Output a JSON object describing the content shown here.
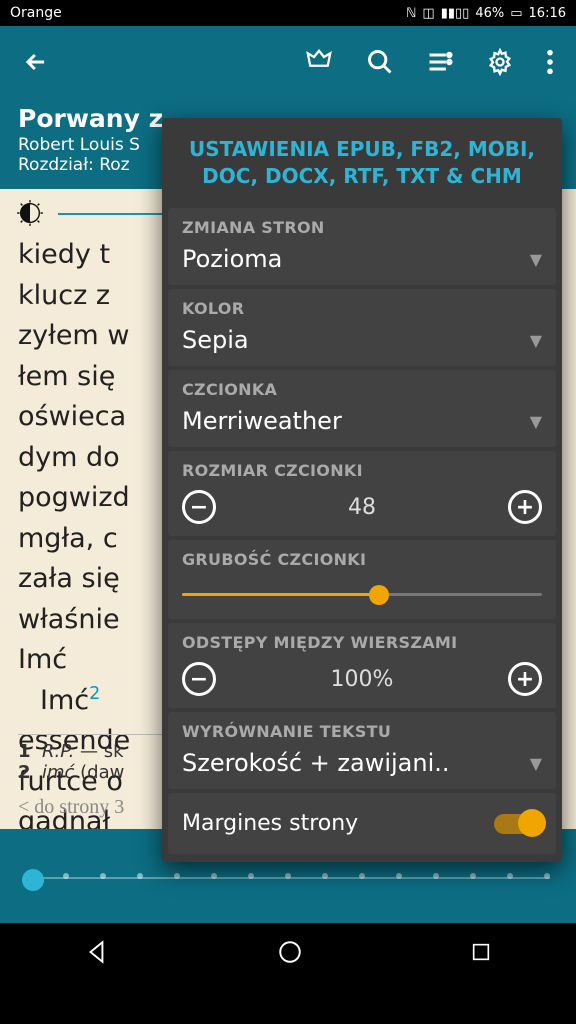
{
  "status": {
    "carrier": "Orange",
    "battery_pct": "46%",
    "time": "16:16"
  },
  "header": {
    "title": "Porwany z",
    "author": "Robert Louis S",
    "chapter": "Rozdział: Roz"
  },
  "reader": {
    "body": "kiedy t\nklucz z\nzyłem w\nłem się\noświeca\ndym do\npogwizd\nmgła, c\nzała się\nwłaśnie\n  Imć",
    "body_sup_ref": "2",
    "body_tail": "essende\nfurtce o\ngadnął",
    "footnote1_num": "1",
    "footnote1_a": "R.P.",
    "footnote1_b": " — sk",
    "footnote2_num": "2",
    "footnote2_a": "imć",
    "footnote2_b": " (daw",
    "page_nav": "< do strony 3"
  },
  "settings": {
    "panel_title": "USTAWIENIA EPUB, FB2, MOBI, DOC, DOCX, RTF, TXT & CHM",
    "page_change": {
      "label": "ZMIANA STRON",
      "value": "Pozioma"
    },
    "color": {
      "label": "KOLOR",
      "value": "Sepia"
    },
    "font": {
      "label": "CZCIONKA",
      "value": "Merriweather"
    },
    "font_size": {
      "label": "ROZMIAR CZCIONKI",
      "value": "48"
    },
    "font_weight": {
      "label": "GRUBOŚĆ CZCIONKI"
    },
    "line_spacing": {
      "label": "ODSTĘPY MIĘDZY WIERSZAMI",
      "value": "100%"
    },
    "text_align": {
      "label": "WYRÓWNANIE TEKSTU",
      "value": "Szerokość + zawijani.."
    },
    "margin": {
      "label": "Margines strony",
      "on": true
    }
  }
}
